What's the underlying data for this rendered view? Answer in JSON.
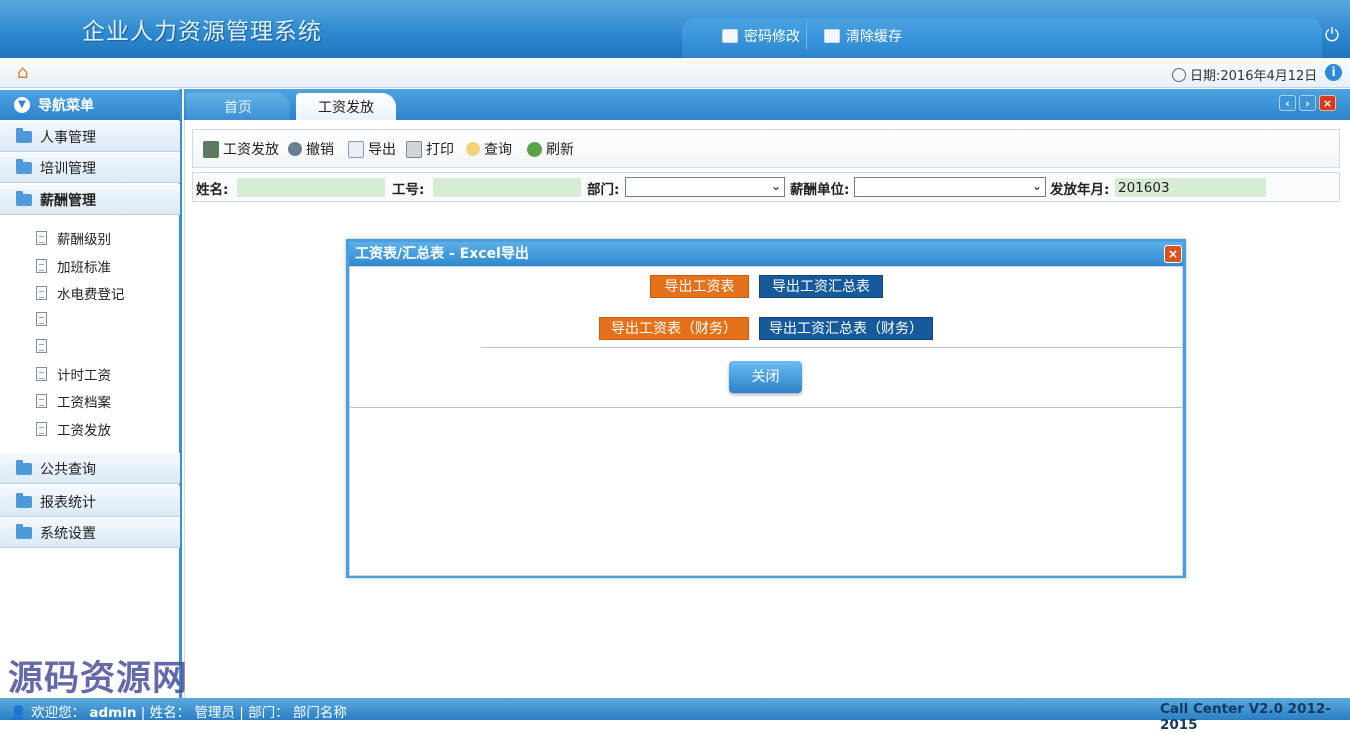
{
  "header": {
    "app_title": "企业人力资源管理系统",
    "change_password": "密码修改",
    "clear_cache": "清除缓存"
  },
  "topbar": {
    "date": "日期:2016年4月12日"
  },
  "sidebar": {
    "nav_title": "导航菜单",
    "groups": [
      {
        "label": "人事管理"
      },
      {
        "label": "培训管理"
      },
      {
        "label": "薪酬管理"
      },
      {
        "label": "公共查询"
      },
      {
        "label": "报表统计"
      },
      {
        "label": "系统设置"
      }
    ],
    "sub_items": [
      {
        "label": "薪酬级别"
      },
      {
        "label": "加班标准"
      },
      {
        "label": "水电费登记"
      },
      {
        "label": ""
      },
      {
        "label": ""
      },
      {
        "label": "计时工资"
      },
      {
        "label": "工资档案"
      },
      {
        "label": "工资发放"
      }
    ]
  },
  "tabs": [
    {
      "label": "首页"
    },
    {
      "label": "工资发放"
    }
  ],
  "toolbar": {
    "issue": "工资发放",
    "revoke": "撤销",
    "export": "导出",
    "print": "打印",
    "query": "查询",
    "refresh": "刷新"
  },
  "filter": {
    "name_label": "姓名:",
    "name_value": "",
    "id_label": "工号:",
    "id_value": "",
    "dept_label": "部门:",
    "dept_value": "",
    "pay_unit_label": "薪酬单位:",
    "pay_unit_value": "",
    "month_label": "发放年月:",
    "month_value": "201603"
  },
  "modal": {
    "title": "工资表/汇总表 - Excel导出",
    "export_salary": "导出工资表",
    "export_summary": "导出工资汇总表",
    "export_salary_finance": "导出工资表（财务）",
    "export_summary_finance": "导出工资汇总表（财务）",
    "close": "关闭"
  },
  "footer": {
    "welcome_label": "欢迎您：",
    "user": "admin",
    "name_label": "姓名：",
    "name": "管理员",
    "dept_label": "部门：",
    "dept": "部门名称",
    "version": "Call Center V2.0 2012-2015"
  },
  "watermark": "源码资源网",
  "colors": {
    "primary_blue": "#2f88cf",
    "export_orange": "#e6711b",
    "export_blue": "#165a9c",
    "input_green": "#d6ecd4"
  }
}
